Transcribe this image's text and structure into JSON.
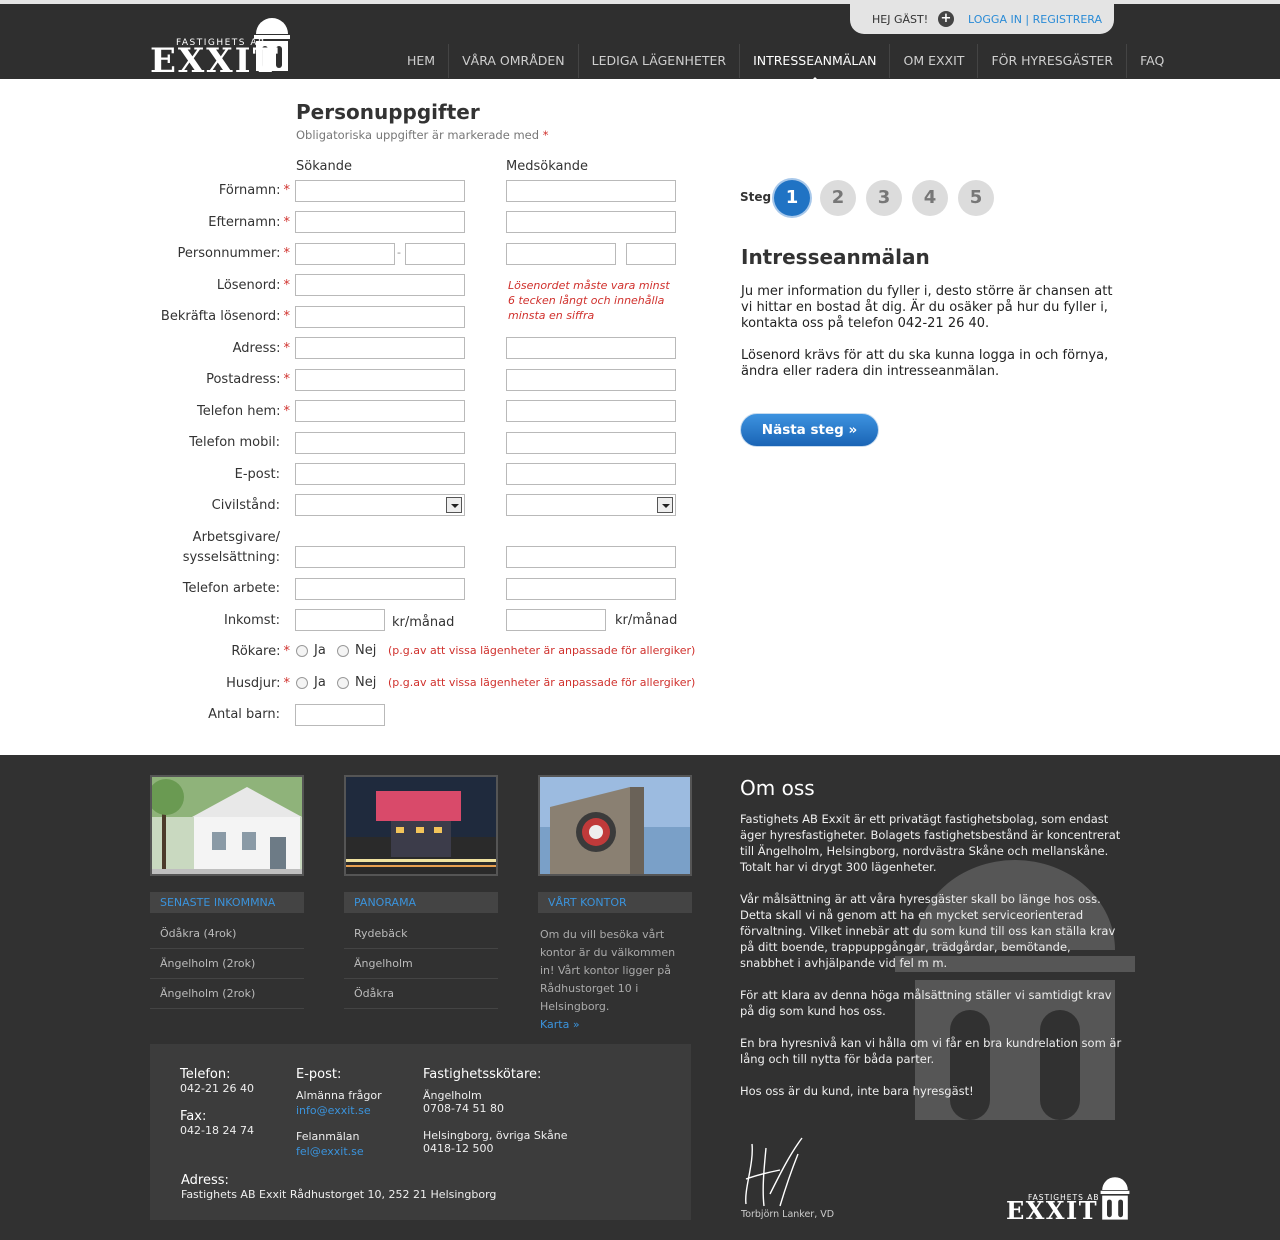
{
  "header": {
    "logo_small": "FASTIGHETS AB",
    "logo_big": "EXXIT",
    "greeting": "HEJ GÄST!",
    "login_link": "LOGGA IN",
    "login_sep": " | ",
    "register_link": "REGISTRERA",
    "nav": [
      "HEM",
      "VÅRA OMRÅDEN",
      "LEDIGA LÄGENHETER",
      "INTRESSEANMÄLAN",
      "OM EXXIT",
      "FÖR HYRESGÄSTER",
      "FAQ"
    ],
    "nav_active": "INTRESSEANMÄLAN"
  },
  "form": {
    "title": "Personuppgifter",
    "subtitle": "Obligatoriska uppgifter är markerade med",
    "required_mark": "*",
    "col_applicant": "Sökande",
    "col_coapplicant": "Medsökande",
    "labels": {
      "firstname": "Förnamn:",
      "lastname": "Efternamn:",
      "ssn": "Personnummer:",
      "password": "Lösenord:",
      "confirm_password": "Bekräfta lösenord:",
      "address": "Adress:",
      "postal": "Postadress:",
      "phone_home": "Telefon hem:",
      "phone_mobile": "Telefon mobil:",
      "email": "E-post:",
      "civil": "Civilstånd:",
      "employer_1": "Arbetsgivare/",
      "employer_2": "sysselsättning:",
      "phone_work": "Telefon arbete:",
      "income": "Inkomst:",
      "smoker": "Rökare:",
      "pets": "Husdjur:",
      "children": "Antal barn:"
    },
    "ssn_dash": "-",
    "income_unit": "kr/månad",
    "password_note": "Lösenordet måste vara minst 6 tecken långt och innehålla minsta en siffra",
    "yes": "Ja",
    "no": "Nej",
    "allergy_note": "(p.g.av att vissa lägenheter är anpassade för allergiker)"
  },
  "steps": {
    "label": "Steg",
    "items": [
      "1",
      "2",
      "3",
      "4",
      "5"
    ],
    "active": 1
  },
  "panel": {
    "title": "Intresseanmälan",
    "p1": "Ju mer information du fyller i, desto större är chansen att vi hittar en bostad åt dig. Är du osäker på hur du fyller i, kontakta oss på telefon 042-21 26 40.",
    "p2": "Lösenord krävs för att du ska kunna logga in och förnya, ändra eller radera din intresseanmälan.",
    "next_button": "Nästa steg »"
  },
  "footer": {
    "latest": {
      "heading": "SENASTE INKOMMNA",
      "items": [
        "Ödåkra (4rok)",
        "Ängelholm (2rok)",
        "Ängelholm (2rok)"
      ]
    },
    "panorama": {
      "heading": "PANORAMA",
      "items": [
        "Rydebäck",
        "Ängelholm",
        "Ödåkra"
      ]
    },
    "office": {
      "heading": "VÅRT KONTOR",
      "text": "Om du vill besöka vårt kontor är du välkommen in! Vårt kontor ligger på Rådhustorget 10 i Helsingborg.",
      "map_link": "Karta »"
    },
    "contact": {
      "phone_label": "Telefon:",
      "phone": "042-21 26 40",
      "fax_label": "Fax:",
      "fax": "042-18 24 74",
      "email_label": "E-post:",
      "general_label": "Almänna frågor",
      "general_email": "info@exxit.se",
      "fault_label": "Felanmälan",
      "fault_email": "fel@exxit.se",
      "caretaker_label": "Fastighetsskötare:",
      "caretaker_1_area": "Ängelholm",
      "caretaker_1_phone": "0708-74 51 80",
      "caretaker_2_area": "Helsingborg, övriga Skåne",
      "caretaker_2_phone": "0418-12 500",
      "address_label": "Adress:",
      "address": "Fastighets AB Exxit Rådhustorget 10, 252 21 Helsingborg"
    },
    "about": {
      "title": "Om oss",
      "p1": "Fastighets AB Exxit är ett privatägt fastighetsbolag, som endast äger hyresfastigheter. Bolagets fastighetsbestånd är koncentrerat till Ängelholm, Helsingborg, nordvästra Skåne och mellanskåne. Totalt har vi drygt 300 lägenheter.",
      "p2": "Vår målsättning är att våra hyresgäster skall bo länge hos oss. Detta skall vi nå genom att ha en mycket serviceorienterad förvaltning. Vilket innebär att du som kund till oss kan ställa krav på ditt boende, trappuppgångar, trädgårdar, bemötande, snabbhet i avhjälpande vid fel m m.",
      "p3": "För att klara av denna höga målsättning ställer vi samtidigt krav på dig som kund hos oss.",
      "p4": "En bra hyresnivå kan vi hålla om vi får en bra kundrelation som är lång och till nytta för båda parter.",
      "p5": "Hos oss är du kund, inte bara hyresgäst!",
      "signature_name": "Torbjörn Lanker, VD"
    },
    "logo_small": "FASTIGHETS AB",
    "logo_big": "EXXIT"
  }
}
